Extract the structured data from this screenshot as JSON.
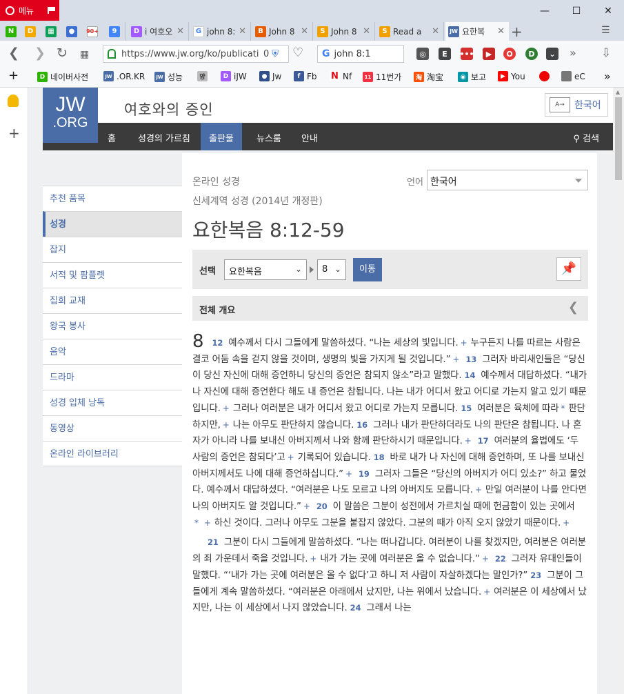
{
  "browser": {
    "menu_label": "메뉴",
    "tabs": [
      {
        "label": "i 여호오",
        "icon": "D"
      },
      {
        "label": "john 8:",
        "icon": "G"
      },
      {
        "label": "John 8",
        "icon": "B"
      },
      {
        "label": "John 8",
        "icon": "S"
      },
      {
        "label": "Read a",
        "icon": "S"
      },
      {
        "label": "요한복",
        "icon": "JW"
      }
    ],
    "pinned_tab_badges": [
      "90+",
      "9"
    ],
    "url": "https://www.jw.org/ko/publication",
    "url_badge": "0",
    "search_query": "john 8:1",
    "bookmarks": [
      "네이버사전",
      ".OR.KR",
      "성능",
      "iJW",
      "Jw",
      "Fb",
      "Nf",
      "11번가",
      "淘宝",
      "보고",
      "You",
      "eC"
    ]
  },
  "site": {
    "logo_line1": "JW",
    "logo_line2": ".ORG",
    "title": "여호와의 증인",
    "language_button": "한국어",
    "nav": [
      "홈",
      "성경의 가르침",
      "출판물",
      "뉴스룸",
      "안내"
    ],
    "nav_search": "검색"
  },
  "leftnav": [
    "추천 품목",
    "성경",
    "잡지",
    "서적 및 팜플렛",
    "집회 교재",
    "왕국 봉사",
    "음악",
    "드라마",
    "성경 입체 낭독",
    "동영상",
    "온라인 라이브러리"
  ],
  "content": {
    "bible_label": "온라인 성경",
    "lang_label": "언어",
    "lang_value": "한국어",
    "edition": "신세계역 성경 (2014년 개정판)",
    "chapter_title": "요한복음 8:12-59",
    "picker_label": "선택",
    "book_value": "요한복음",
    "chapter_value": "8",
    "go_label": "이동",
    "overview_label": "전체 개요"
  },
  "text": {
    "chapter": "8",
    "p1": [
      {
        "n": "12",
        "t": "예수께서 다시 그들에게 말씀하셨다. “나는 세상의 빛입니다."
      },
      {
        "p": "+",
        "t": "누구든지 나를 따르는 사람은 결코 어둠 속을 걷지 않을 것이며, 생명의 빛을 가지게 될 것입니다.”"
      },
      {
        "p": "+"
      },
      {
        "n": "13",
        "t": "그러자 바리새인들은 “당신이 당신 자신에 대해 증언하니 당신의 증언은 참되지 않소”라고 말했다."
      },
      {
        "n": "14",
        "t": "예수께서 대답하셨다. “내가 나 자신에 대해 증언한다 해도 내 증언은 참됩니다. 나는 내가 어디서 왔고 어디로 가는지 알고 있기 때문입니다."
      },
      {
        "p": "+",
        "t": "그러나 여러분은 내가 어디서 왔고 어디로 가는지 모릅니다."
      },
      {
        "n": "15",
        "t": "여러분은 육체에 따라"
      },
      {
        "p": "*",
        "t": "판단하지만,"
      },
      {
        "p": "+",
        "t": "나는 아무도 판단하지 않습니다."
      },
      {
        "n": "16",
        "t": "그러나 내가 판단하더라도 나의 판단은 참됩니다. 나 혼자가 아니라 나를 보내신 아버지께서 나와 함께 판단하시기 때문입니다."
      },
      {
        "p": "+"
      },
      {
        "n": "17",
        "t": "여러분의 율법에도 ‘두 사람의 증언은 참되다’고"
      },
      {
        "p": "+",
        "t": "기록되어 있습니다."
      },
      {
        "n": "18",
        "t": "바로 내가 나 자신에 대해 증언하며, 또 나를 보내신 아버지께서도 나에 대해 증언하십니다.”"
      },
      {
        "p": "+"
      },
      {
        "n": "19",
        "t": "그러자 그들은 “당신의 아버지가 어디 있소?” 하고 물었다. 예수께서 대답하셨다. “여러분은 나도 모르고 나의 아버지도 모릅니다."
      },
      {
        "p": "+",
        "t": "만일 여러분이 나를 안다면 나의 아버지도 알 것입니다.”"
      },
      {
        "p": "+"
      },
      {
        "n": "20",
        "t": "이 말씀은 그분이 성전에서 가르치실 때에 헌금함이 있는 곳에서"
      },
      {
        "p": "*"
      },
      {
        "p": "+",
        "t": "하신 것이다. 그러나 아무도 그분을 붙잡지 않았다. 그분의 때가 아직 오지 않았기 때문이다."
      },
      {
        "p": "+"
      }
    ],
    "p2": [
      {
        "n": "21",
        "t": "그분이 다시 그들에게 말씀하셨다. “나는 떠나갑니다. 여러분이 나를 찾겠지만, 여러분은 여러분의 죄 가운데서 죽을 것입니다."
      },
      {
        "p": "+",
        "t": "내가 가는 곳에 여러분은 올 수 없습니다.”"
      },
      {
        "p": "+"
      },
      {
        "n": "22",
        "t": "그러자 유대인들이 말했다. “‘내가 가는 곳에 여러분은 올 수 없다’고 하니 저 사람이 자살하겠다는 말인가?”"
      },
      {
        "n": "23",
        "t": "그분이 그들에게 계속 말씀하셨다. “여러분은 아래에서 났지만, 나는 위에서 났습니다."
      },
      {
        "p": "+",
        "t": "여러분은 이 세상에서 났지만, 나는 이 세상에서 나지 않았습니다."
      },
      {
        "n": "24",
        "t": "그래서 나는"
      }
    ]
  }
}
